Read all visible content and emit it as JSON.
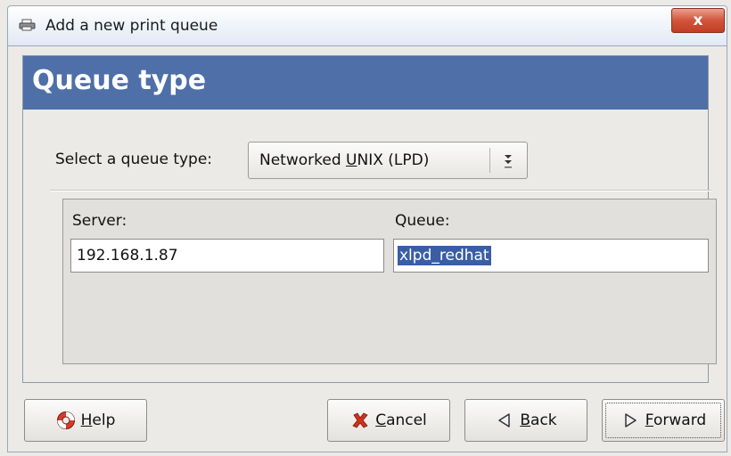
{
  "window": {
    "title": "Add a new print queue",
    "close_label": "x"
  },
  "header": {
    "title": "Queue type"
  },
  "queue_type": {
    "label": "Select a queue type:",
    "selected_pre": "Networked ",
    "selected_mnemonic": "U",
    "selected_post": "NIX (LPD)"
  },
  "fields": {
    "server_label": "Server:",
    "server_value": "192.168.1.87",
    "queue_label": "Queue:",
    "queue_value": "xlpd_redhat"
  },
  "buttons": {
    "help": {
      "mnemonic": "H",
      "rest": "elp"
    },
    "cancel": {
      "mnemonic": "C",
      "rest": "ancel"
    },
    "back": {
      "mnemonic": "B",
      "rest": "ack"
    },
    "forward": {
      "mnemonic": "F",
      "rest": "orward"
    }
  },
  "colors": {
    "header_bg": "#4e6fa7",
    "selection_bg": "#3a5ea6",
    "close_button": "#c13e25"
  },
  "icons": {
    "title": "printer-icon",
    "combo": "dropdown-arrow-icon",
    "help": "lifebuoy-icon",
    "cancel": "red-x-icon",
    "back": "left-triangle-icon",
    "forward": "right-triangle-icon"
  }
}
